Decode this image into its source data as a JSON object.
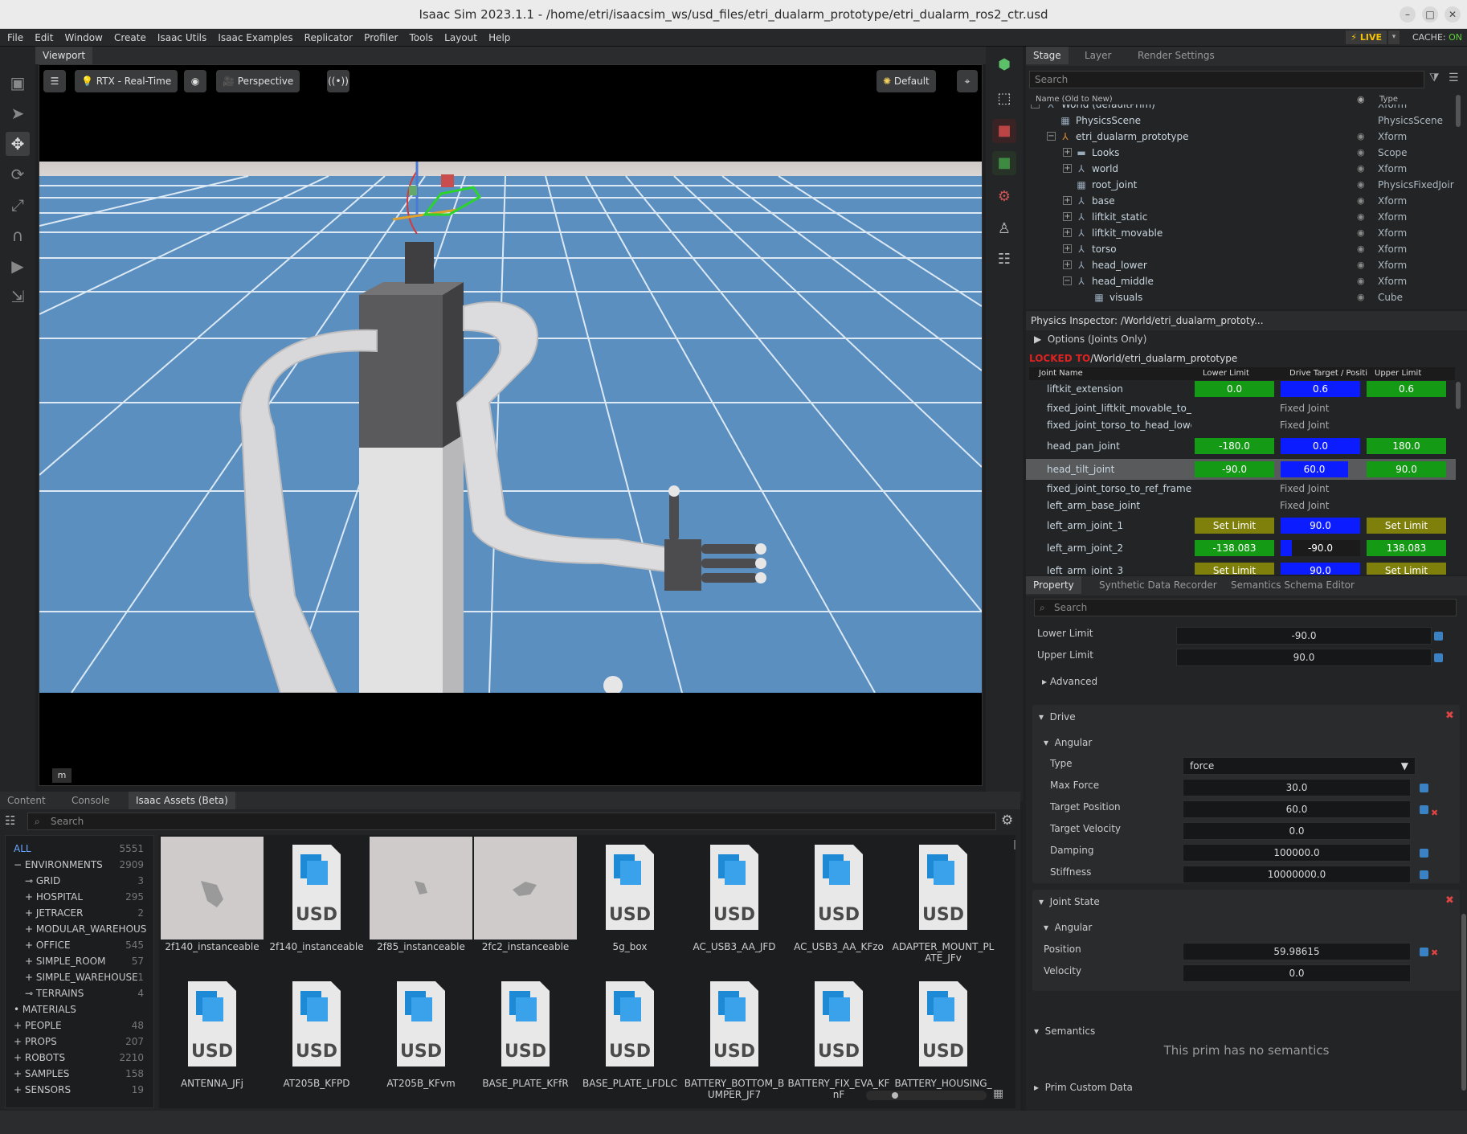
{
  "window": {
    "title": "Isaac Sim 2023.1.1 - /home/etri/isaacsim_ws/usd_files/etri_dualarm_prototype/etri_dualarm_ros2_ctr.usd",
    "minimize": "–",
    "maximize": "□",
    "close": "✕"
  },
  "menu": [
    "File",
    "Edit",
    "Window",
    "Create",
    "Isaac Utils",
    "Isaac Examples",
    "Replicator",
    "Profiler",
    "Tools",
    "Layout",
    "Help"
  ],
  "live": {
    "label": "LIVE",
    "cache_label": "CACHE:",
    "cache_state": "ON",
    "dropdown": "▾"
  },
  "viewport": {
    "tab": "Viewport",
    "renderer": "RTX - Real-Time",
    "camera": "Perspective",
    "lighting": "Default",
    "unit_badge": "m"
  },
  "stage": {
    "tabs": [
      "Stage",
      "Layer",
      "Render Settings"
    ],
    "search_placeholder": "Search",
    "col_name": "Name (Old to New)",
    "col_type": "Type",
    "rows": [
      {
        "name": "World (defaultPrim)",
        "type": "Xform"
      },
      {
        "name": "PhysicsScene",
        "type": "PhysicsScene"
      },
      {
        "name": "etri_dualarm_prototype",
        "type": "Xform"
      },
      {
        "name": "Looks",
        "type": "Scope"
      },
      {
        "name": "world",
        "type": "Xform"
      },
      {
        "name": "root_joint",
        "type": "PhysicsFixedJoir"
      },
      {
        "name": "base",
        "type": "Xform"
      },
      {
        "name": "liftkit_static",
        "type": "Xform"
      },
      {
        "name": "liftkit_movable",
        "type": "Xform"
      },
      {
        "name": "torso",
        "type": "Xform"
      },
      {
        "name": "head_lower",
        "type": "Xform"
      },
      {
        "name": "head_middle",
        "type": "Xform"
      },
      {
        "name": "visuals",
        "type": "Cube"
      }
    ]
  },
  "physics_inspector": {
    "title": "Physics Inspector: /World/etri_dualarm_prototy...",
    "options": "Options (Joints Only)",
    "locked_label": "LOCKED TO",
    "path": "/World/etri_dualarm_prototype",
    "headers": [
      "Joint Name",
      "Lower Limit",
      "Drive Target / Positi",
      "Upper Limit"
    ],
    "joints": [
      {
        "name": "liftkit_extension",
        "lower": "0.0",
        "target": "0.6",
        "upper": "0.6"
      },
      {
        "name": "fixed_joint_liftkit_movable_to_tors",
        "fixed": "Fixed Joint"
      },
      {
        "name": "fixed_joint_torso_to_head_lower",
        "fixed": "Fixed Joint"
      },
      {
        "name": "head_pan_joint",
        "lower": "-180.0",
        "target": "0.0",
        "upper": "180.0"
      },
      {
        "name": "head_tilt_joint",
        "lower": "-90.0",
        "target": "60.0",
        "upper": "90.0"
      },
      {
        "name": "fixed_joint_torso_to_ref_frame_left",
        "fixed": "Fixed Joint"
      },
      {
        "name": "left_arm_base_joint",
        "fixed": "Fixed Joint"
      },
      {
        "name": "left_arm_joint_1",
        "lower": "Set Limit",
        "target": "90.0",
        "upper": "Set Limit"
      },
      {
        "name": "left_arm_joint_2",
        "lower": "-138.083",
        "target": "-90.0",
        "upper": "138.083"
      },
      {
        "name": "left_arm_joint_3",
        "lower": "Set Limit",
        "target": "90.0",
        "upper": "Set Limit"
      }
    ]
  },
  "property": {
    "tabs": [
      "Property",
      "Synthetic Data Recorder",
      "Semantics Schema Editor"
    ],
    "search_placeholder": "Search",
    "lower_limit_label": "Lower Limit",
    "lower_limit": "-90.0",
    "upper_limit_label": "Upper Limit",
    "upper_limit": "90.0",
    "advanced": "Advanced",
    "drive": {
      "title": "Drive",
      "angular": "Angular",
      "type_label": "Type",
      "type": "force",
      "max_force_label": "Max Force",
      "max_force": "30.0",
      "target_position_label": "Target Position",
      "target_position": "60.0",
      "target_velocity_label": "Target Velocity",
      "target_velocity": "0.0",
      "damping_label": "Damping",
      "damping": "100000.0",
      "stiffness_label": "Stiffness",
      "stiffness": "10000000.0"
    },
    "joint_state": {
      "title": "Joint State",
      "angular": "Angular",
      "position_label": "Position",
      "position": "59.98615",
      "velocity_label": "Velocity",
      "velocity": "0.0"
    },
    "semantics": {
      "title": "Semantics",
      "message": "This prim has no semantics"
    },
    "prim_custom_data": "Prim Custom Data"
  },
  "bottom": {
    "tabs": [
      "Content",
      "Console",
      "Isaac Assets (Beta)"
    ],
    "search_placeholder": "Search",
    "categories": [
      {
        "name": "ALL",
        "count": "5551"
      },
      {
        "name": "ENVIRONMENTS",
        "count": "2909"
      },
      {
        "name": "GRID",
        "count": "3"
      },
      {
        "name": "HOSPITAL",
        "count": "295"
      },
      {
        "name": "JETRACER",
        "count": "2"
      },
      {
        "name": "MODULAR_WAREHOUS",
        "count": ""
      },
      {
        "name": "OFFICE",
        "count": "545"
      },
      {
        "name": "SIMPLE_ROOM",
        "count": "57"
      },
      {
        "name": "SIMPLE_WAREHOUSE",
        "count": "1"
      },
      {
        "name": "TERRAINS",
        "count": "4"
      },
      {
        "name": "MATERIALS",
        "count": ""
      },
      {
        "name": "PEOPLE",
        "count": "48"
      },
      {
        "name": "PROPS",
        "count": "207"
      },
      {
        "name": "ROBOTS",
        "count": "2210"
      },
      {
        "name": "SAMPLES",
        "count": "158"
      },
      {
        "name": "SENSORS",
        "count": "19"
      }
    ],
    "assets": [
      {
        "name": "2f140_instanceable",
        "kind": "preview"
      },
      {
        "name": "2f140_instanceable",
        "kind": "usd"
      },
      {
        "name": "2f85_instanceable",
        "kind": "preview"
      },
      {
        "name": "2fc2_instanceable",
        "kind": "preview"
      },
      {
        "name": "5g_box",
        "kind": "usd"
      },
      {
        "name": "AC_USB3_AA_JFD",
        "kind": "usd"
      },
      {
        "name": "AC_USB3_AA_KFzo",
        "kind": "usd"
      },
      {
        "name": "ADAPTER_MOUNT_PLATE_JFv",
        "kind": "usd"
      },
      {
        "name": "ANTENNA_JFj",
        "kind": "usd"
      },
      {
        "name": "AT205B_KFPD",
        "kind": "usd"
      },
      {
        "name": "AT205B_KFvm",
        "kind": "usd"
      },
      {
        "name": "BASE_PLATE_KFfR",
        "kind": "usd"
      },
      {
        "name": "BASE_PLATE_LFDLC",
        "kind": "usd"
      },
      {
        "name": "BATTERY_BOTTOM_BUMPER_JF7",
        "kind": "usd"
      },
      {
        "name": "BATTERY_FIX_EVA_KFnF",
        "kind": "usd"
      },
      {
        "name": "BATTERY_HOUSING_KF",
        "kind": "usd"
      }
    ],
    "usd_label": "USD"
  },
  "colors": {
    "limit_green": "#159a15",
    "target_blue": "#0b1dff",
    "unset_olive": "#7f7f0c",
    "live_yellow": "#f5c400",
    "cache_green": "#5fcf3a",
    "floor_blue": "#4f85b4"
  }
}
